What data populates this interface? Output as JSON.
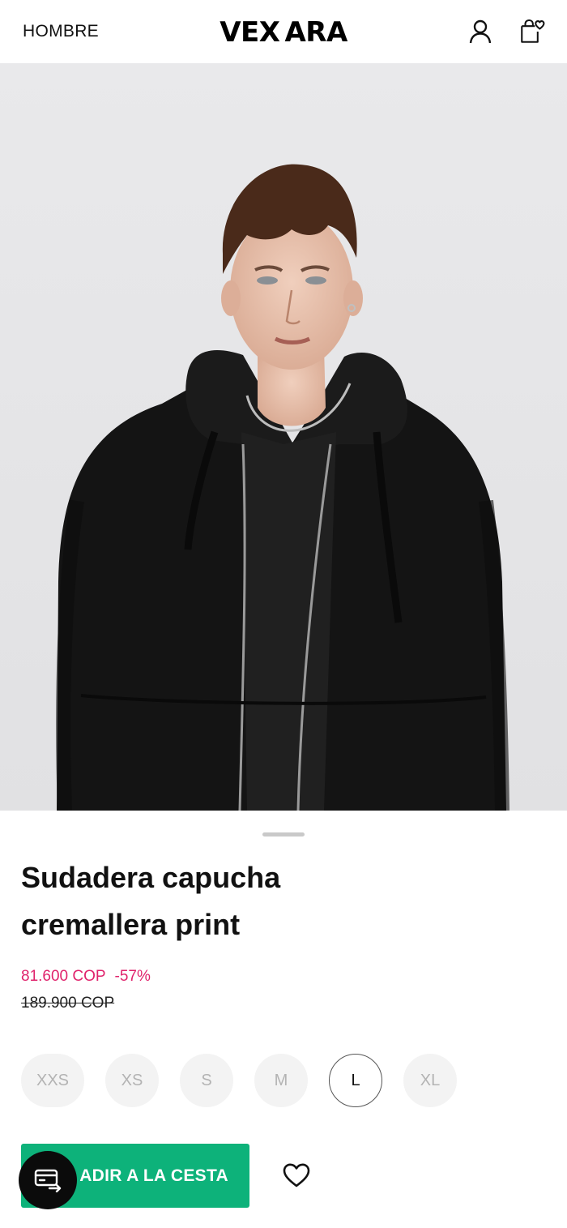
{
  "header": {
    "nav_label": "HOMBRE",
    "logo": "VEXARA",
    "account_icon": "user-icon",
    "bag_icon": "shopping-bag-heart-icon"
  },
  "product": {
    "image_alt": "Model wearing black zip hoodie",
    "title": "Sudadera capucha cremallera print",
    "price_current": "81.600 COP",
    "discount": "-57%",
    "price_original": "189.900 COP"
  },
  "sizes": {
    "options": [
      "XXS",
      "XS",
      "S",
      "M",
      "L",
      "XL"
    ],
    "selected": "L"
  },
  "actions": {
    "add_to_cart_visible": "ADIR A LA CESTA",
    "wishlist_icon": "heart-icon",
    "payment_fab_icon": "card-transfer-icon"
  },
  "colors": {
    "accent_price": "#e0236c",
    "cta_green": "#0db27a"
  }
}
